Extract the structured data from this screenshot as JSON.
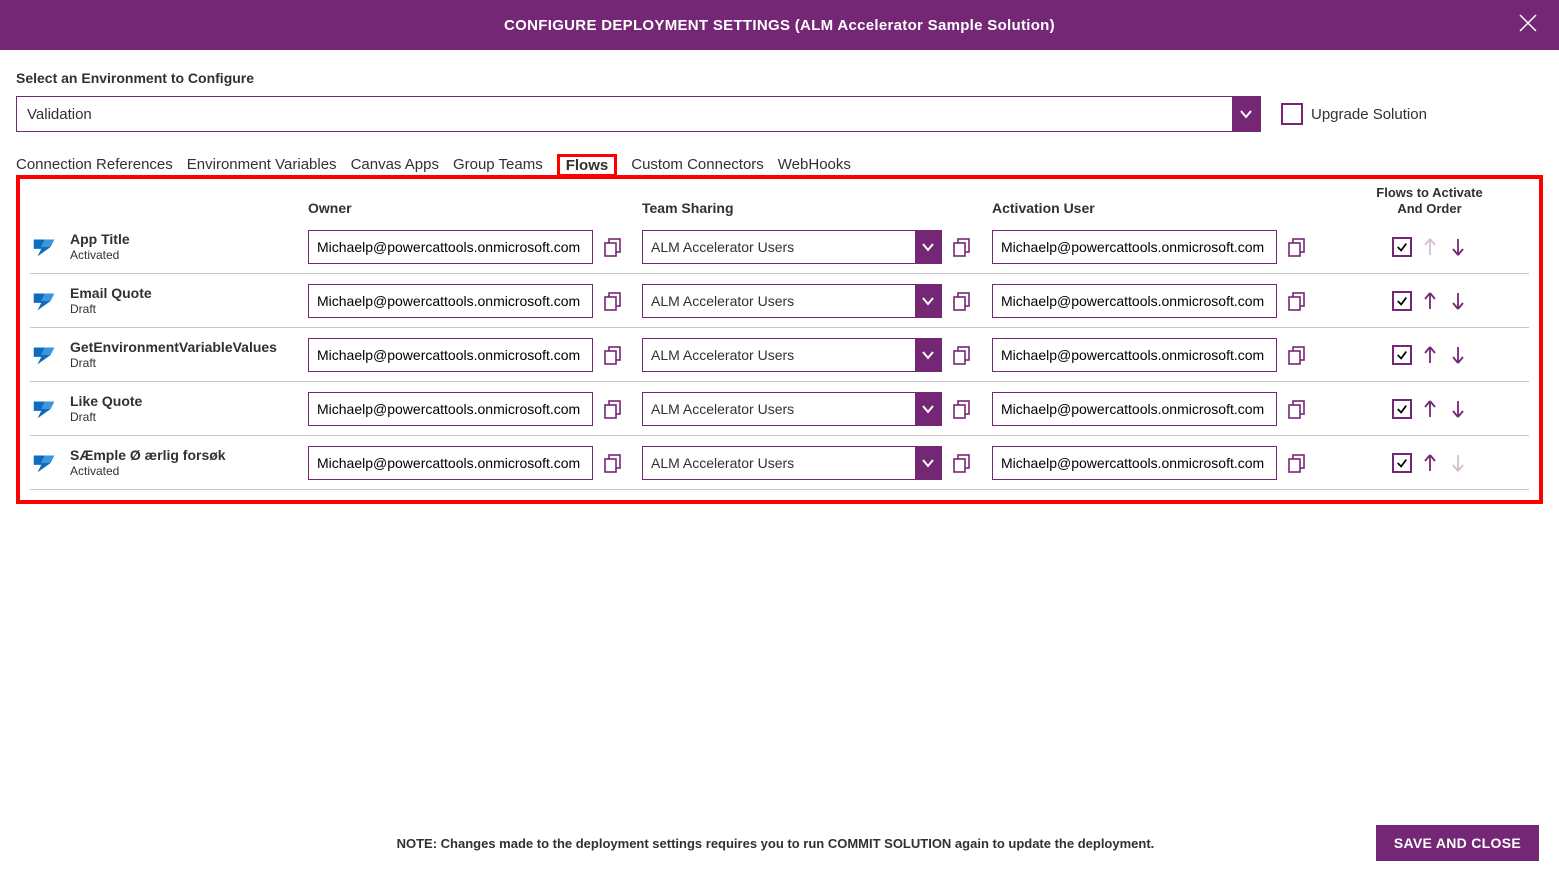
{
  "header": {
    "title": "CONFIGURE DEPLOYMENT SETTINGS (ALM Accelerator Sample Solution)"
  },
  "envLabel": "Select an Environment to Configure",
  "envValue": "Validation",
  "upgradeLabel": "Upgrade Solution",
  "upgradeChecked": false,
  "tabs": [
    "Connection References",
    "Environment Variables",
    "Canvas Apps",
    "Group Teams",
    "Flows",
    "Custom Connectors",
    "WebHooks"
  ],
  "activeTab": "Flows",
  "headers": {
    "owner": "Owner",
    "team": "Team Sharing",
    "activation": "Activation User",
    "order": "Flows to Activate And Order"
  },
  "defaults": {
    "owner": "Michaelp@powercattools.onmicrosoft.com",
    "team": "ALM Accelerator Users",
    "activation": "Michaelp@powercattools.onmicrosoft.com"
  },
  "flows": [
    {
      "name": "App Title",
      "status": "Activated",
      "activate": true,
      "upEnabled": false,
      "downEnabled": true
    },
    {
      "name": "Email Quote",
      "status": "Draft",
      "activate": true,
      "upEnabled": true,
      "downEnabled": true
    },
    {
      "name": "GetEnvironmentVariableValues",
      "status": "Draft",
      "activate": true,
      "upEnabled": true,
      "downEnabled": true
    },
    {
      "name": "Like Quote",
      "status": "Draft",
      "activate": true,
      "upEnabled": true,
      "downEnabled": true
    },
    {
      "name": "SÆmple Ø ærlig forsøk",
      "status": "Activated",
      "activate": true,
      "upEnabled": true,
      "downEnabled": false
    }
  ],
  "footer": {
    "note": "NOTE: Changes made to the deployment settings requires you to run COMMIT SOLUTION again to update the deployment.",
    "saveLabel": "SAVE AND CLOSE"
  }
}
